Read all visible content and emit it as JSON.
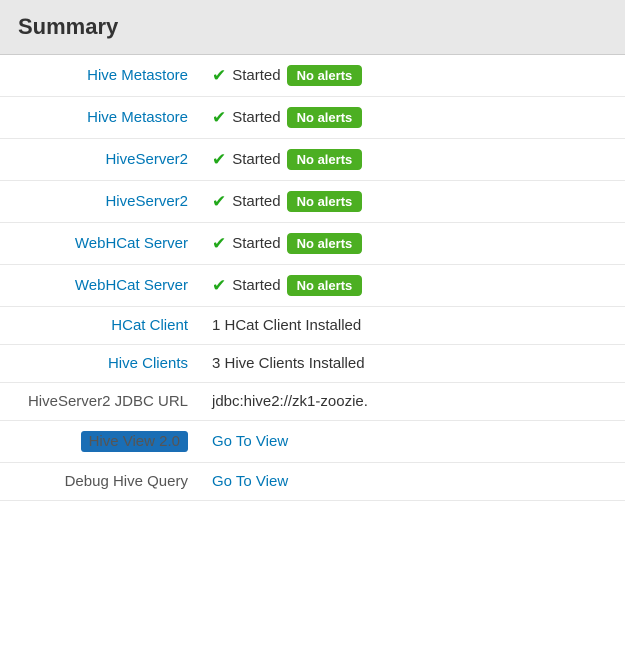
{
  "header": {
    "title": "Summary"
  },
  "rows": [
    {
      "id": "hive-metastore-1",
      "label": "Hive Metastore",
      "label_type": "link",
      "value_type": "status",
      "status": "Started",
      "badge": "No alerts"
    },
    {
      "id": "hive-metastore-2",
      "label": "Hive Metastore",
      "label_type": "link",
      "value_type": "status",
      "status": "Started",
      "badge": "No alerts"
    },
    {
      "id": "hiveserver2-1",
      "label": "HiveServer2",
      "label_type": "link",
      "value_type": "status",
      "status": "Started",
      "badge": "No alerts"
    },
    {
      "id": "hiveserver2-2",
      "label": "HiveServer2",
      "label_type": "link",
      "value_type": "status",
      "status": "Started",
      "badge": "No alerts"
    },
    {
      "id": "webhcat-server-1",
      "label": "WebHCat Server",
      "label_type": "link",
      "value_type": "status",
      "status": "Started",
      "badge": "No alerts"
    },
    {
      "id": "webhcat-server-2",
      "label": "WebHCat Server",
      "label_type": "link",
      "value_type": "status",
      "status": "Started",
      "badge": "No alerts"
    },
    {
      "id": "hcat-client",
      "label": "HCat Client",
      "label_type": "link",
      "value_type": "info",
      "info": "1 HCat Client Installed"
    },
    {
      "id": "hive-clients",
      "label": "Hive Clients",
      "label_type": "link",
      "value_type": "info",
      "info": "3 Hive Clients Installed"
    },
    {
      "id": "jdbc-url",
      "label": "HiveServer2 JDBC URL",
      "label_type": "text",
      "value_type": "jdbc",
      "info": "jdbc:hive2://zk1-zoozie."
    },
    {
      "id": "hive-view",
      "label": "Hive View 2.0",
      "label_type": "highlight",
      "value_type": "goto",
      "link_text": "Go To View"
    },
    {
      "id": "debug-hive-query",
      "label": "Debug Hive Query",
      "label_type": "text",
      "value_type": "goto",
      "link_text": "Go To View"
    }
  ],
  "icons": {
    "check": "✔"
  }
}
